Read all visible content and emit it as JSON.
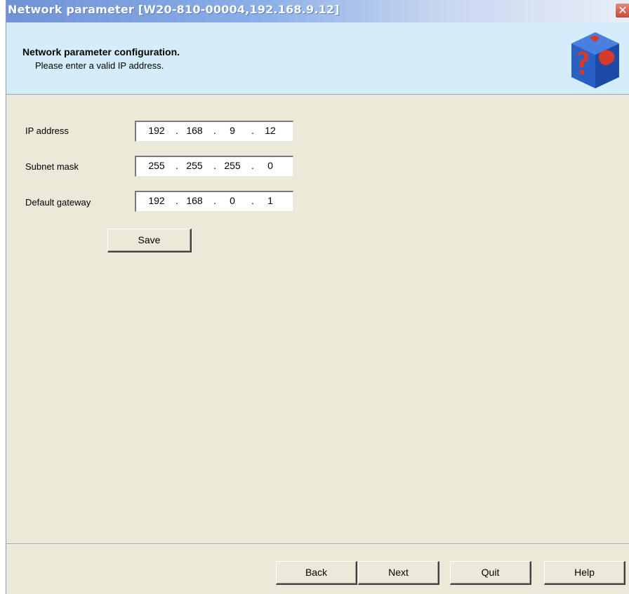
{
  "window": {
    "title": "Network parameter [W20-810-00004,192.168.9.12]",
    "close_label": "✕"
  },
  "header": {
    "heading": "Network parameter configuration.",
    "subtext": "Please enter a valid IP address.",
    "logo_icon": "cube-help-logo-icon"
  },
  "form": {
    "ip_address": {
      "label": "IP address",
      "octets": [
        "192",
        "168",
        "9",
        "12"
      ]
    },
    "subnet_mask": {
      "label": "Subnet mask",
      "octets": [
        "255",
        "255",
        "255",
        "0"
      ]
    },
    "default_gateway": {
      "label": "Default gateway",
      "octets": [
        "192",
        "168",
        "0",
        "1"
      ]
    },
    "save_label": "Save"
  },
  "footer": {
    "back_label": "Back",
    "next_label": "Next",
    "quit_label": "Quit",
    "help_label": "Help"
  },
  "colors": {
    "title_bar": "#7c9fdf",
    "header_bg": "#d3eefa",
    "window_bg": "#ece9d8",
    "logo_blue": "#2a5fc4",
    "logo_red": "#d63a2a"
  }
}
